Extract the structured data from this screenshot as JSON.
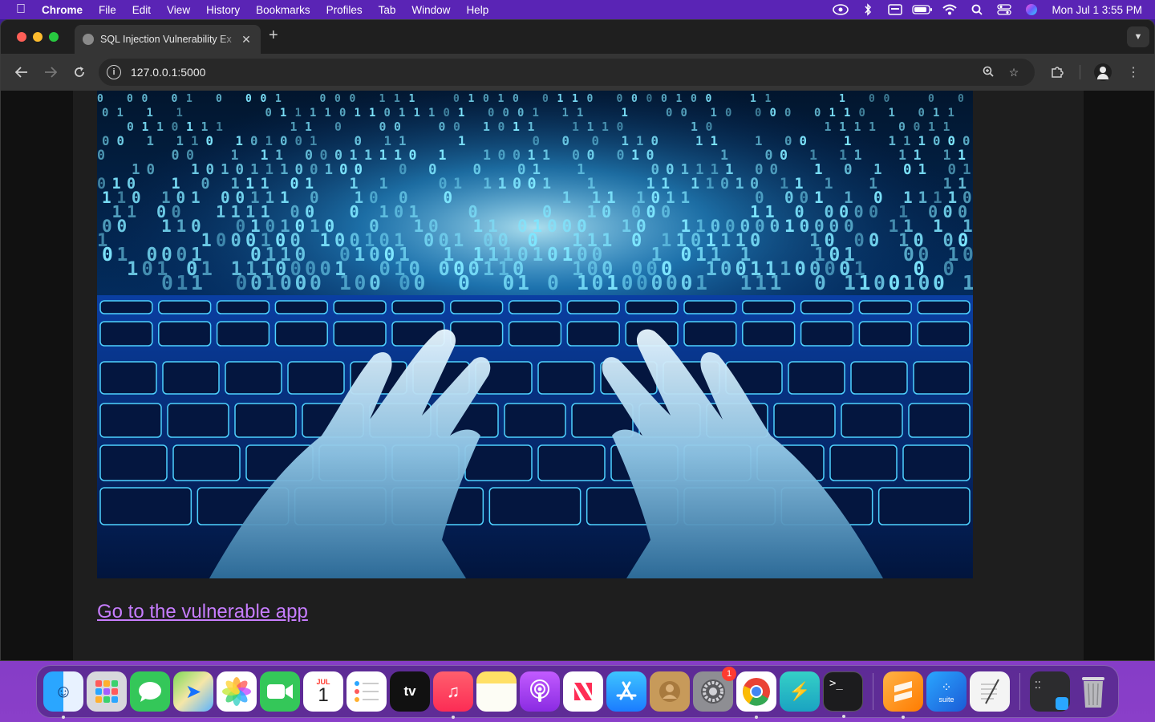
{
  "menubar": {
    "app_name": "Chrome",
    "items": [
      "File",
      "Edit",
      "View",
      "History",
      "Bookmarks",
      "Profiles",
      "Tab",
      "Window",
      "Help"
    ],
    "clock": "Mon Jul 1  3:55 PM"
  },
  "browser": {
    "tab_title": "SQL Injection Vulnerability Ex",
    "url": "127.0.0.1:5000"
  },
  "page": {
    "hero_alt": "Hands typing on a glowing blue keyboard with binary code",
    "link_text": "Go to the vulnerable app"
  },
  "dock": {
    "calendar_month": "JUL",
    "calendar_day": "1",
    "settings_badge": "1",
    "suite_label": "suite",
    "apps": [
      "finder",
      "launchpad",
      "messages",
      "maps",
      "photos",
      "facetime",
      "calendar",
      "reminders",
      "apple-tv",
      "music",
      "notes",
      "podcasts",
      "news",
      "app-store",
      "contacts",
      "system-settings",
      "chrome",
      "bolt-app",
      "terminal",
      "sublime-text",
      "suite-app",
      "textedit",
      "screenshot-tool",
      "trash"
    ]
  },
  "colors": {
    "link": "#c77dff",
    "menubar_bg": "#5a24b5",
    "toolbar_bg": "#353535"
  }
}
